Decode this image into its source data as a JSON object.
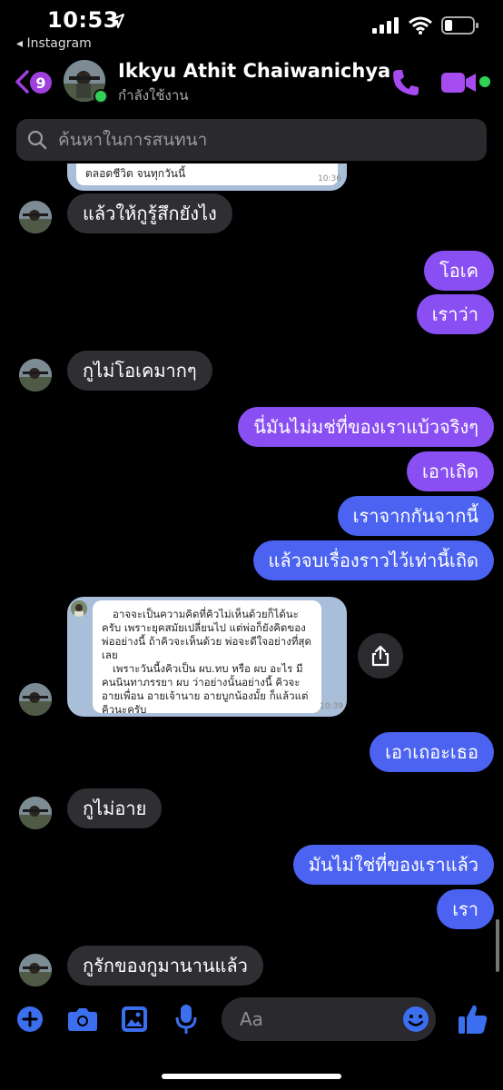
{
  "status_bar": {
    "time": "10:53",
    "back_app": "Instagram"
  },
  "header": {
    "unread_count": "9",
    "contact_name": "Ikkyu Athit Chaiwanichya",
    "contact_status": "กำลังใช้งาน"
  },
  "search": {
    "placeholder": "ค้นหาในการสนทนา"
  },
  "messages": {
    "m0_cut_text": "ตลอดชีวิต จนทุกวันนี้",
    "m0_time": "10:36",
    "m1": "แล้วให้กูรู้สึกยังไง",
    "m2": "โอเค",
    "m3": "เราว่า",
    "m4": "กูไม่โอเคมากๆ",
    "m5": "นี่มันไม่มช่ที่ของเราแบ้วจริงๆ",
    "m6": "เอาเถิด",
    "m7": "เราจากกันจากนี้",
    "m8": "แล้วจบเรื่องราวไว้เท่านี้เถิด",
    "m9_p1": "อาจจะเป็นความคิดที่คิวไม่เห็นด้วยก็ได้นะครับ เพราะยุคสมัยเปลี่ยนไป แต่พ่อก็ยังคิดของพ่ออย่างนี้ ถ้าคิวจะเห็นด้วย พ่อจะดีใจอย่างที่สุดเลย",
    "m9_p2": "เพราะวันนี้งคิวเป็น ผบ.ทบ หรือ ผบ อะไร มีคนนินทาภรรยา ผบ ว่าอย่างนั้นอย่างนี้ คิวจะอายเพื่อน อายเจ้านาย อายบูกน้องมั้ย ก็แล้วแต่คิวนะครับ",
    "m9_time": "10:39",
    "m10": "เอาเถอะเธอ",
    "m11": "กูไม่อาย",
    "m12": "มันไม่ใช่ที่ของเราแล้ว",
    "m13": "เรา",
    "m14": "กูรักของกูมานานแล้ว"
  },
  "composer": {
    "placeholder": "Aa"
  },
  "colors": {
    "accent_purple": "#9f3fe0",
    "outgoing_purple": "#8a4ff2",
    "outgoing_blue": "#4b63f0",
    "incoming": "#2f2f33",
    "online": "#31d158"
  },
  "icons": [
    "location-arrow-icon",
    "signal-icon",
    "wifi-icon",
    "battery-icon",
    "back-chevron-icon",
    "phone-icon",
    "video-camera-icon",
    "search-icon",
    "share-icon",
    "plus-icon",
    "camera-icon",
    "image-icon",
    "microphone-icon",
    "emoji-icon",
    "thumbs-up-icon"
  ]
}
